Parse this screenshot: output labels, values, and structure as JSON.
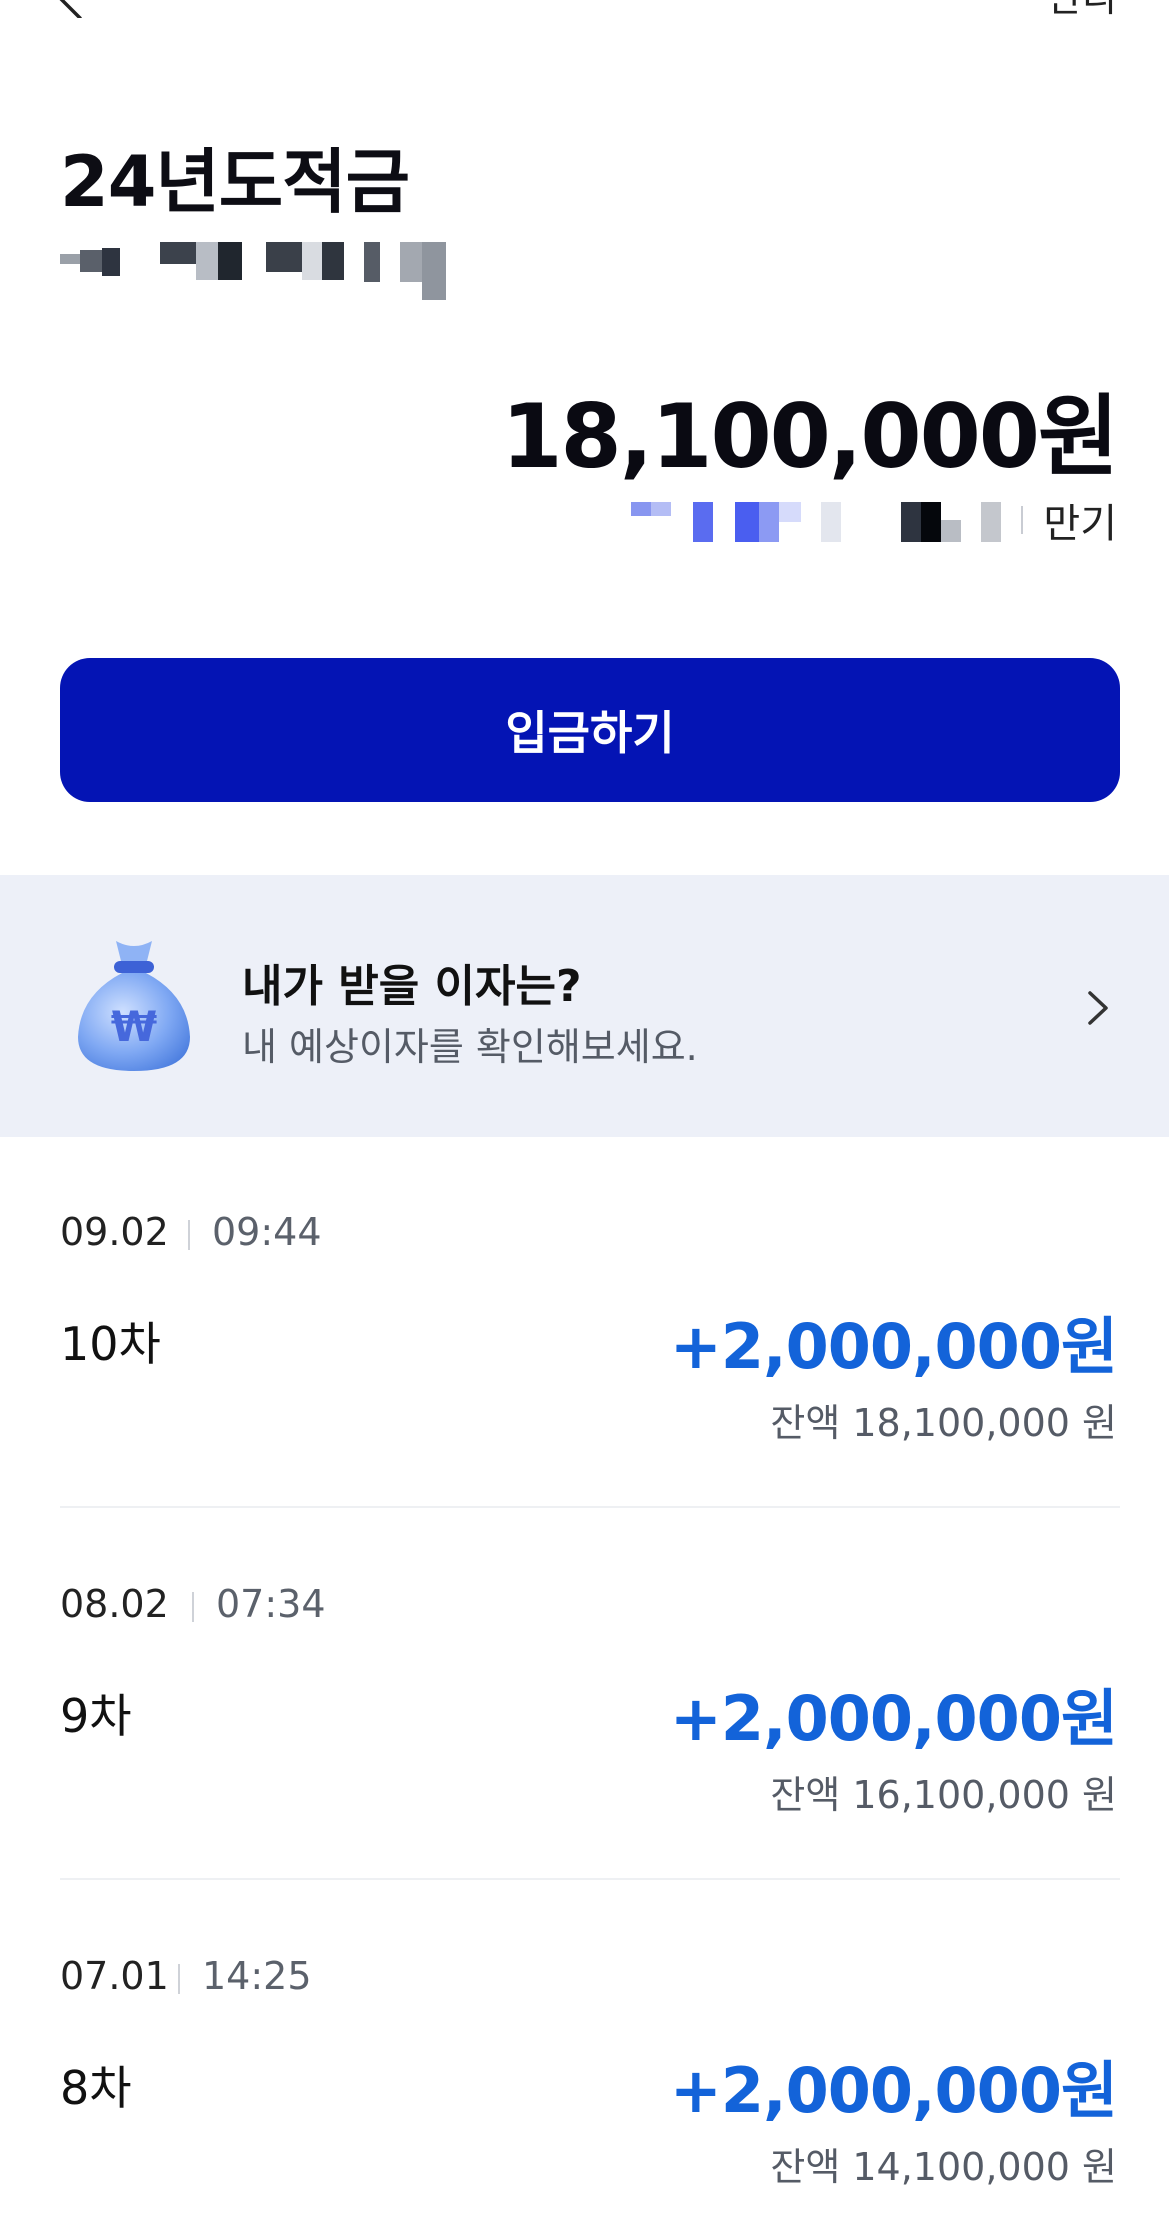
{
  "header": {
    "manage_label": "관리"
  },
  "account": {
    "name": "24년도적금",
    "balance": "18,100,000원",
    "maturity_label": "만기"
  },
  "actions": {
    "deposit_label": "입금하기"
  },
  "interest_banner": {
    "title": "내가 받을 이자는?",
    "subtitle": "내 예상이자를 확인해보세요."
  },
  "transactions": [
    {
      "date": "09.02",
      "time": "09:44",
      "label": "10차",
      "amount": "+2,000,000원",
      "balance": "잔액 18,100,000 원"
    },
    {
      "date": "08.02",
      "time": "07:34",
      "label": "9차",
      "amount": "+2,000,000원",
      "balance": "잔액 16,100,000 원"
    },
    {
      "date": "07.01",
      "time": "14:25",
      "label": "8차",
      "amount": "+2,000,000원",
      "balance": "잔액 14,100,000 원"
    }
  ],
  "colors": {
    "primary": "#0414b4",
    "amount_blue": "#1363d9",
    "banner_bg": "#edf0f8"
  }
}
